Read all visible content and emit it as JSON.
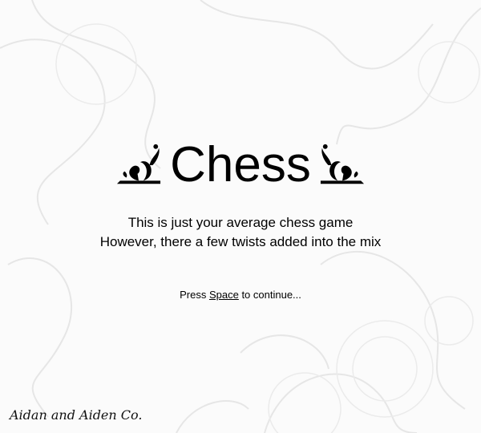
{
  "title": "Chess",
  "description": {
    "line1": "This is just your average chess game",
    "line2": "However, there a few twists added into the mix"
  },
  "prompt": {
    "before": "Press ",
    "key": "Space",
    "after": " to continue..."
  },
  "credit": "Aidan and Aiden Co.",
  "colors": {
    "background": "#fbfbfb",
    "swirl": "#e6e6e6",
    "text": "#000000"
  },
  "icons": {
    "left": "ornament-flourish-icon",
    "right": "ornament-flourish-icon"
  }
}
